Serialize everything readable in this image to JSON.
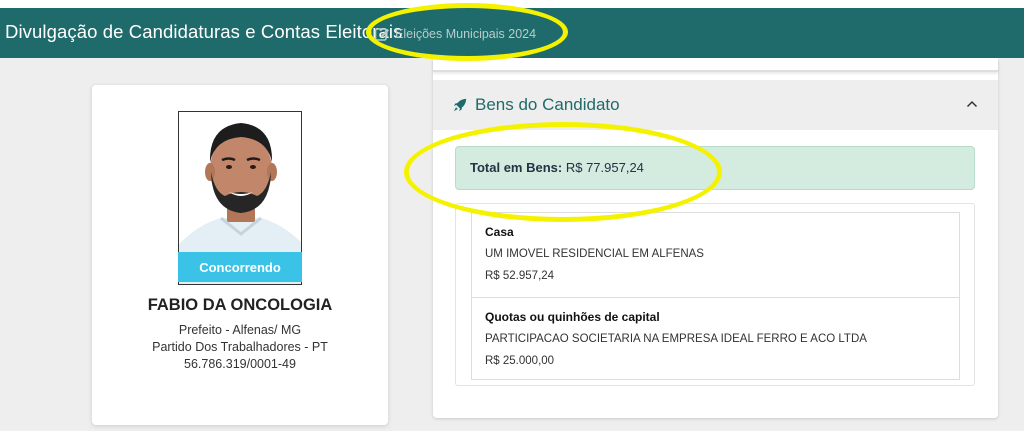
{
  "header": {
    "app_title": "Divulgação de Candidaturas e Contas Eleitorais",
    "election_label": "Eleições Municipais 2024",
    "background_color": "#1f6b6b"
  },
  "candidate": {
    "status": "Concorrendo",
    "name": "FABIO DA ONCOLOGIA",
    "office": "Prefeito - Alfenas/ MG",
    "party": "Partido Dos Trabalhadores - PT",
    "cnpj": "56.786.319/0001-49",
    "status_color": "#3ac3e6"
  },
  "assets_section": {
    "title": "Bens do Candidato",
    "icon": "rocket-icon",
    "total_label": "Total em Bens:",
    "total_value": "R$ 77.957,24",
    "items": [
      {
        "type": "Casa",
        "description": "UM IMOVEL RESIDENCIAL EM ALFENAS",
        "value": "R$ 52.957,24"
      },
      {
        "type": "Quotas ou quinhões de capital",
        "description": "PARTICIPACAO SOCIETARIA NA EMPRESA IDEAL FERRO E ACO LTDA",
        "value": "R$ 25.000,00"
      }
    ]
  },
  "annotations": {
    "highlight_color": "#f5f200"
  }
}
